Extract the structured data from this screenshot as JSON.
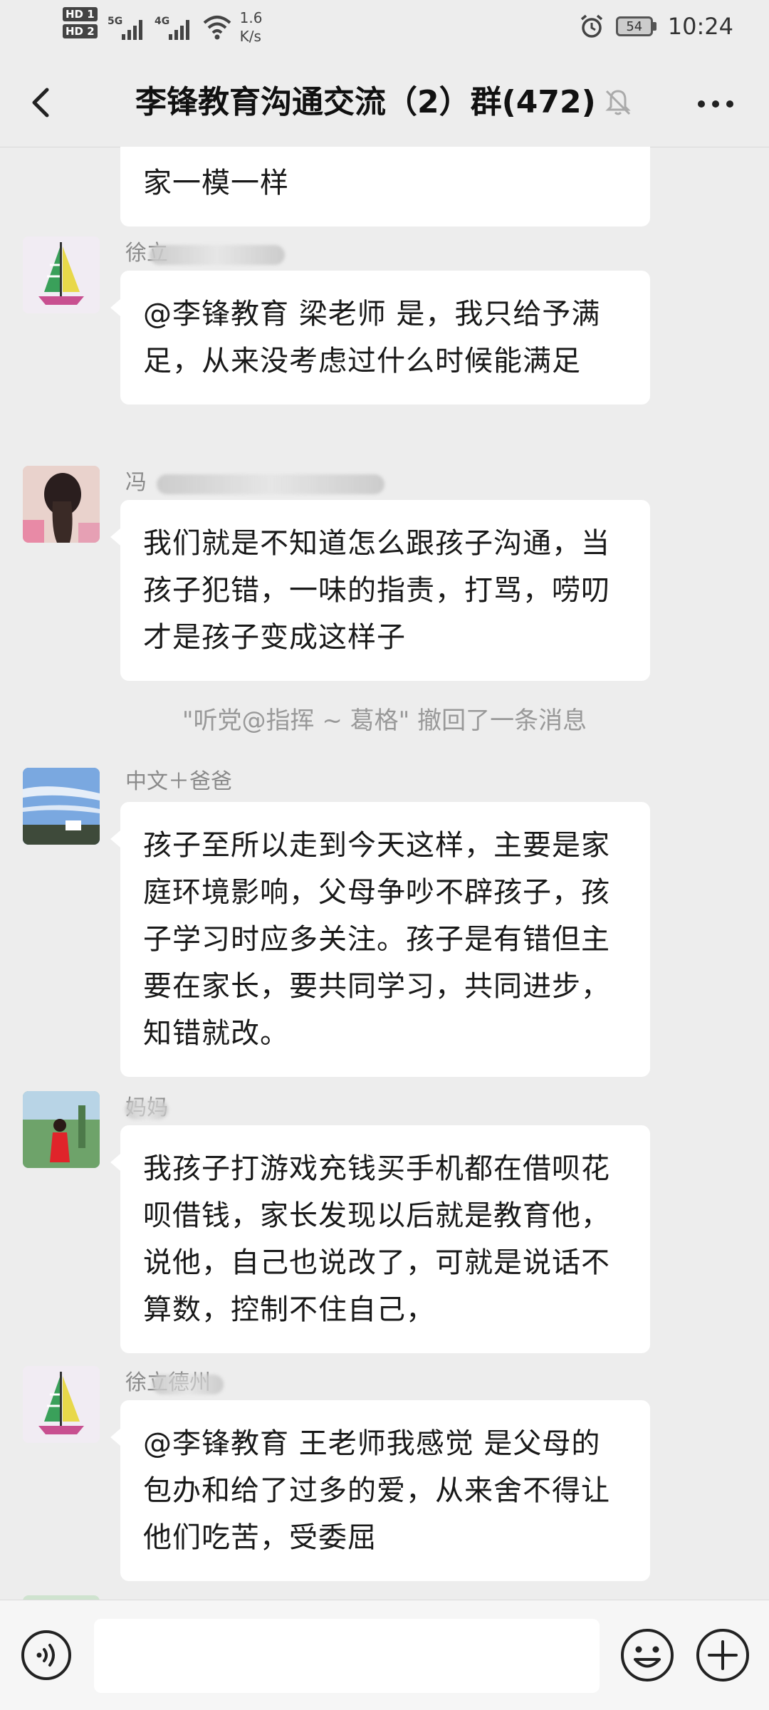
{
  "status_bar": {
    "hd1": "HD 1",
    "hd2": "HD 2",
    "net1": "5G",
    "net2": "4G",
    "speed_value": "1.6",
    "speed_unit": "K/s",
    "battery": "54",
    "time": "10:24"
  },
  "header": {
    "title": "李锋教育沟通交流（2）群(472)",
    "icons": [
      "back-arrow-icon",
      "mute-bell-icon",
      "more-dots-icon"
    ]
  },
  "messages": [
    {
      "sender": "",
      "text": "家一模一样",
      "continuation": true
    },
    {
      "sender": "徐立",
      "text": "@李锋教育 梁老师  是，我只给予满足，从来没考虑过什么时候能满足",
      "avatar": "sailboat"
    },
    {
      "sender": "冯",
      "text": "我们就是不知道怎么跟孩子沟通，当孩子犯错，一味的指责，打骂，唠叨才是孩子变成这样子",
      "avatar": "girl-braid"
    },
    {
      "system": "\"听党@指挥 ~ 葛格\" 撤回了一条消息"
    },
    {
      "sender": "中文＋爸爸",
      "text": "孩子至所以走到今天这样，主要是家庭环境影响，父母争吵不辟孩子，孩子学习时应多关注。孩子是有错但主要在家长，要共同学习，共同进步，知错就改。",
      "avatar": "sky"
    },
    {
      "sender": "妈妈",
      "text": "我孩子打游戏充钱买手机都在借呗花呗借钱，家长发现以后就是教育他，说他，自己也说改了，可就是说话不算数，控制不住自己，",
      "avatar": "lady-red"
    },
    {
      "sender": "徐立德州",
      "text": "@李锋教育 王老师我感觉  是父母的包办和给了过多的爱，从来舍不得让他们吃苦，受委屈",
      "avatar": "sailboat"
    }
  ],
  "input": {
    "value": "",
    "icons": [
      "voice-icon",
      "emoji-icon",
      "plus-icon"
    ]
  },
  "colors": {
    "background": "#ededed",
    "bubble": "#ffffff",
    "sender": "#8a8a8a",
    "system": "#999999"
  }
}
